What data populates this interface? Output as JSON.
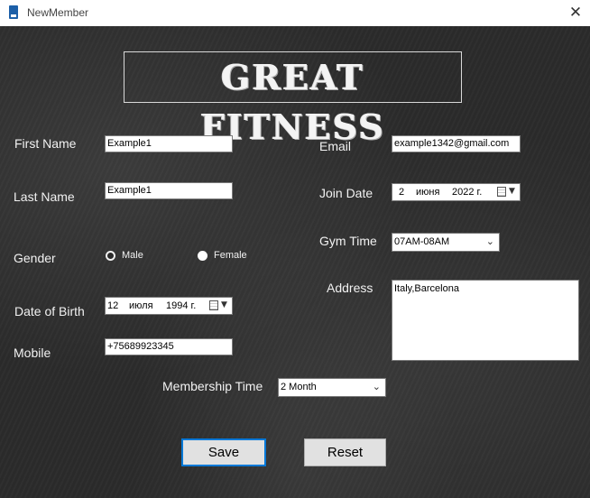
{
  "window": {
    "title": "NewMember",
    "close_glyph": "✕"
  },
  "logo": {
    "text": "GREAT FITNESS"
  },
  "form": {
    "first_name": {
      "label": "First Name",
      "value": "Example1"
    },
    "last_name": {
      "label": "Last Name",
      "value": "Example1"
    },
    "gender": {
      "label": "Gender",
      "options": [
        "Male",
        "Female"
      ],
      "selected": "Female"
    },
    "dob": {
      "label": "Date of Birth",
      "day": "12",
      "month": "июля",
      "year": "1994 г."
    },
    "mobile": {
      "label": "Mobile",
      "value": "+75689923345"
    },
    "email": {
      "label": "Email",
      "value": "example1342@gmail.com"
    },
    "join_date": {
      "label": "Join Date",
      "day": "2",
      "month": "июня",
      "year": "2022 г."
    },
    "gym_time": {
      "label": "Gym Time",
      "value": "07AM-08AM"
    },
    "address": {
      "label": "Address",
      "value": "Italy,Barcelona"
    },
    "membership": {
      "label": "Membership Time",
      "value": "2 Month"
    }
  },
  "buttons": {
    "save": "Save",
    "reset": "Reset"
  },
  "colors": {
    "background": "#2b2b2b",
    "focus": "#0078d7",
    "label": "#f2f2f2"
  },
  "icons": [
    "app-icon",
    "close-icon",
    "calendar-icon",
    "dropdown-arrow-icon",
    "chevron-down-icon"
  ]
}
